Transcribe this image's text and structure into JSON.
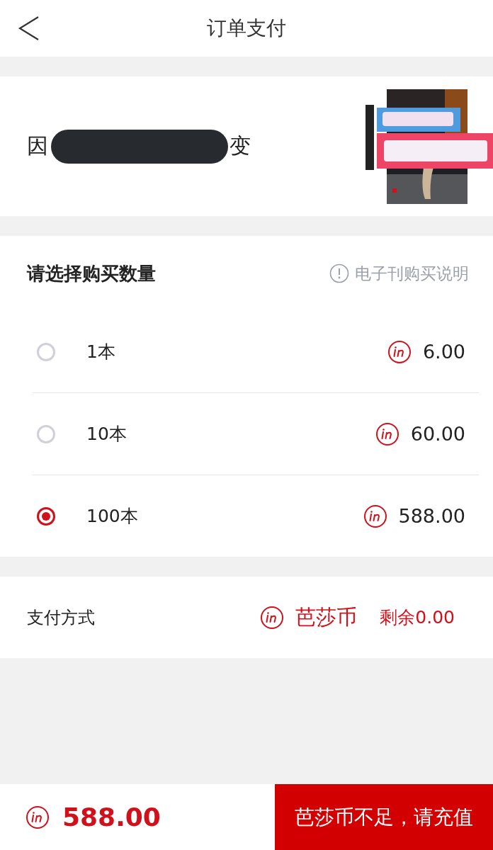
{
  "nav": {
    "title": "订单支付"
  },
  "product": {
    "title_start": "因",
    "title_end": "变",
    "redacted": true
  },
  "quantity": {
    "heading": "请选择购买数量",
    "help_link": "电子刊购买说明",
    "options": [
      {
        "label": "1本",
        "price": "6.00",
        "selected": false
      },
      {
        "label": "10本",
        "price": "60.00",
        "selected": false
      },
      {
        "label": "100本",
        "price": "588.00",
        "selected": true
      }
    ]
  },
  "payment": {
    "label": "支付方式",
    "method": "芭莎币",
    "balance": "剩余0.00"
  },
  "footer": {
    "total": "588.00",
    "button": "芭莎币不足，请充值"
  }
}
